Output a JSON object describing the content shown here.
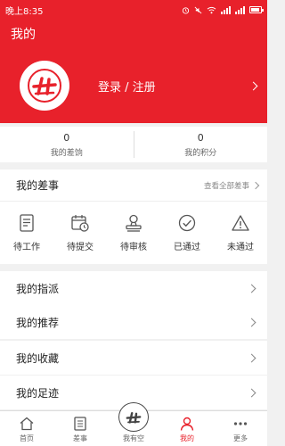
{
  "status_bar": {
    "time": "晚上8:35"
  },
  "title_bar": {
    "title": "我的"
  },
  "profile": {
    "login_text": "登录 / 注册"
  },
  "stats": [
    {
      "value": "0",
      "label": "我的差饷"
    },
    {
      "value": "0",
      "label": "我的积分"
    }
  ],
  "tasks": {
    "title": "我的差事",
    "view_all": "查看全部差事",
    "items": [
      {
        "label": "待工作",
        "icon": "document-icon"
      },
      {
        "label": "待提交",
        "icon": "calendar-clock-icon"
      },
      {
        "label": "待审核",
        "icon": "stamp-icon"
      },
      {
        "label": "已通过",
        "icon": "check-circle-icon"
      },
      {
        "label": "未通过",
        "icon": "warning-triangle-icon"
      }
    ]
  },
  "menu": [
    {
      "label": "我的指派"
    },
    {
      "label": "我的推荐"
    },
    {
      "label": "我的收藏"
    },
    {
      "label": "我的足迹"
    }
  ],
  "tabbar": [
    {
      "label": "首页",
      "icon": "home-icon"
    },
    {
      "label": "差事",
      "icon": "list-icon"
    },
    {
      "label": "我有空",
      "icon": "logo-icon"
    },
    {
      "label": "我的",
      "icon": "person-icon",
      "active": true
    },
    {
      "label": "更多",
      "icon": "more-icon"
    }
  ],
  "colors": {
    "brand": "#e8212b"
  }
}
